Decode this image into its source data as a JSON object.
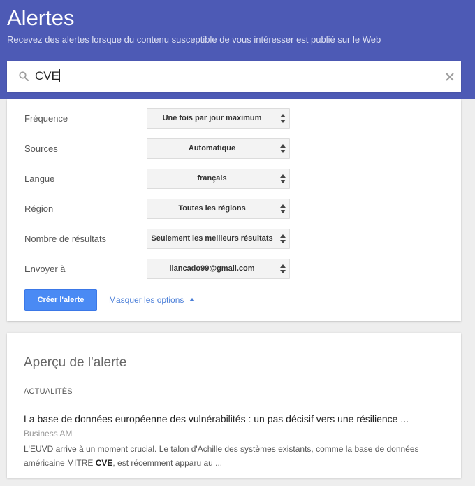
{
  "header": {
    "title": "Alertes",
    "subtitle": "Recevez des alertes lorsque du contenu susceptible de vous intéresser est publié sur le Web"
  },
  "search": {
    "value": "CVE",
    "search_icon": "search-icon",
    "clear_icon": "close-icon"
  },
  "options": {
    "fields": [
      {
        "label": "Fréquence",
        "value": "Une fois par jour maximum"
      },
      {
        "label": "Sources",
        "value": "Automatique"
      },
      {
        "label": "Langue",
        "value": "français"
      },
      {
        "label": "Région",
        "value": "Toutes les régions"
      },
      {
        "label": "Nombre de résultats",
        "value": "Seulement les meilleurs résultats"
      },
      {
        "label": "Envoyer à",
        "value": "ilancado99@gmail.com"
      }
    ],
    "create_label": "Créer l'alerte",
    "hide_options_label": "Masquer les options"
  },
  "preview": {
    "title": "Aperçu de l'alerte",
    "section": "ACTUALITÉS",
    "article": {
      "title": "La base de données européenne des vulnérabilités : un pas décisif vers une résilience ...",
      "source": "Business AM",
      "snippet_line1": "L'EUVD arrive à un moment crucial. Le talon d'Achille des systèmes existants, comme la base de données",
      "snippet_pre": "américaine MITRE ",
      "snippet_bold": "CVE",
      "snippet_post": ", est récemment apparu au ..."
    }
  },
  "colors": {
    "header_bg": "#4d5ab5",
    "button_bg": "#4a8af4",
    "link": "#4a7ed8",
    "page_bg": "#eeeeee"
  }
}
